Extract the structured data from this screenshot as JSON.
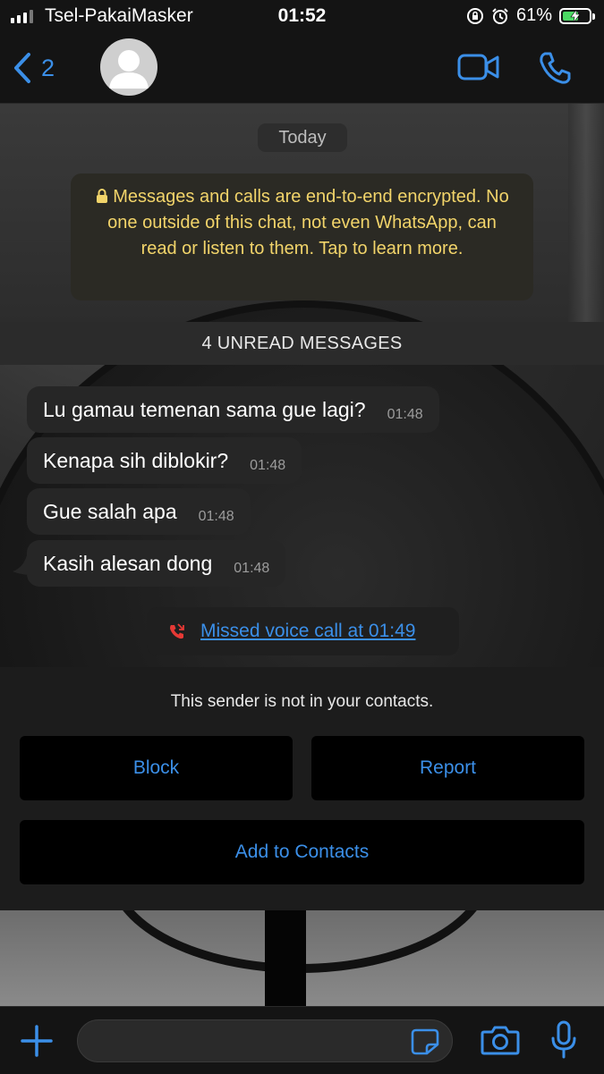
{
  "status_bar": {
    "carrier": "Tsel-PakaiMasker",
    "time": "01:52",
    "battery_percent": "61%",
    "battery_level": 0.61
  },
  "header": {
    "back_count": "2",
    "accent_color": "#3b8fe8"
  },
  "chat": {
    "date_label": "Today",
    "encryption_notice": "Messages and calls are end-to-end encrypted. No one outside of this chat, not even WhatsApp, can read or listen to them. Tap to learn more.",
    "unread_label": "4 UNREAD MESSAGES",
    "messages": [
      {
        "text": "Lu gamau temenan sama gue lagi?",
        "time": "01:48"
      },
      {
        "text": "Kenapa sih diblokir?",
        "time": "01:48"
      },
      {
        "text": "Gue salah apa",
        "time": "01:48"
      },
      {
        "text": "Kasih alesan dong",
        "time": "01:48"
      }
    ],
    "missed_call": "Missed voice call at 01:49"
  },
  "unknown_sender": {
    "notice": "This sender is not in your contacts.",
    "block_label": "Block",
    "report_label": "Report",
    "add_contact_label": "Add to Contacts"
  },
  "icons": {
    "header": [
      "chevron-left-icon",
      "avatar-placeholder-icon",
      "video-call-icon",
      "phone-icon"
    ],
    "input": [
      "plus-icon",
      "sticker-icon",
      "camera-icon",
      "microphone-icon"
    ]
  }
}
